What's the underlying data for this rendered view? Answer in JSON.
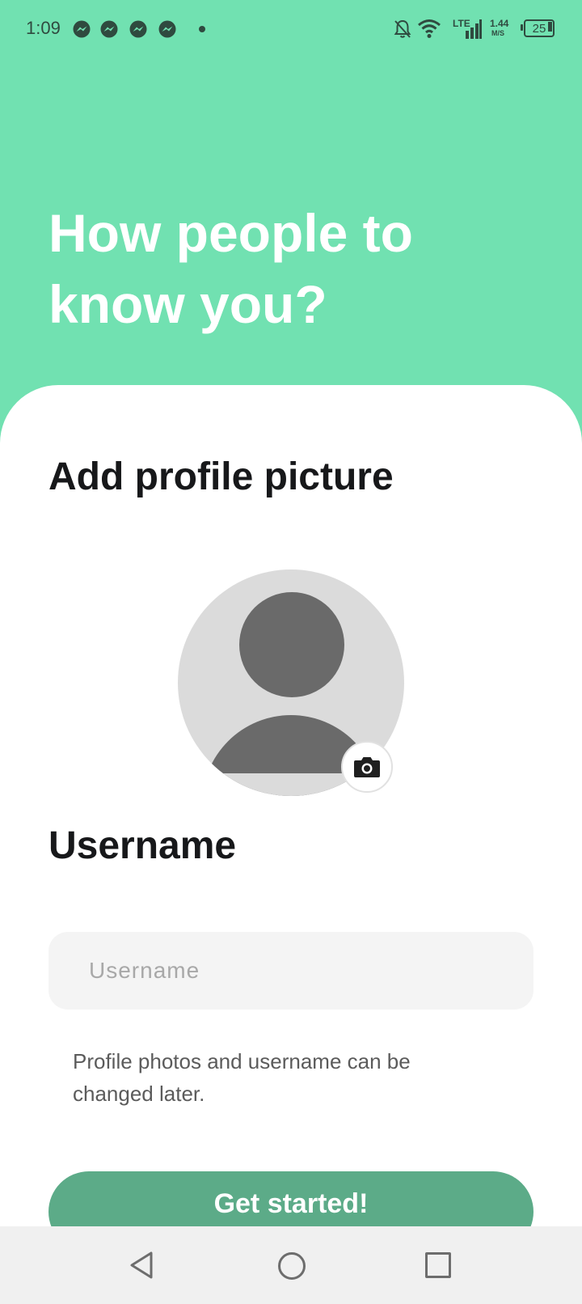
{
  "status_bar": {
    "time": "1:09",
    "notification_icons": [
      "messenger-icon",
      "messenger-icon",
      "messenger-icon",
      "messenger-icon"
    ],
    "network_type": "LTE",
    "speed_value": "1.44",
    "speed_unit": "M/S",
    "battery_level": "25"
  },
  "header": {
    "title": "How people to know you?"
  },
  "profile": {
    "section_title": "Add profile picture",
    "avatar_icon": "person-icon",
    "camera_icon": "camera-icon"
  },
  "username": {
    "section_title": "Username",
    "placeholder": "Username",
    "value": "",
    "helper_text": "Profile photos and username can be changed later."
  },
  "actions": {
    "primary_label": "Get started!"
  },
  "nav_bar": {
    "back_icon": "back-triangle-icon",
    "home_icon": "home-circle-icon",
    "recents_icon": "recents-square-icon"
  },
  "colors": {
    "header_bg": "#71e1b1",
    "button_bg": "#5cab88",
    "card_bg": "#ffffff",
    "input_bg": "#f4f4f4",
    "title_text": "#17181a"
  }
}
